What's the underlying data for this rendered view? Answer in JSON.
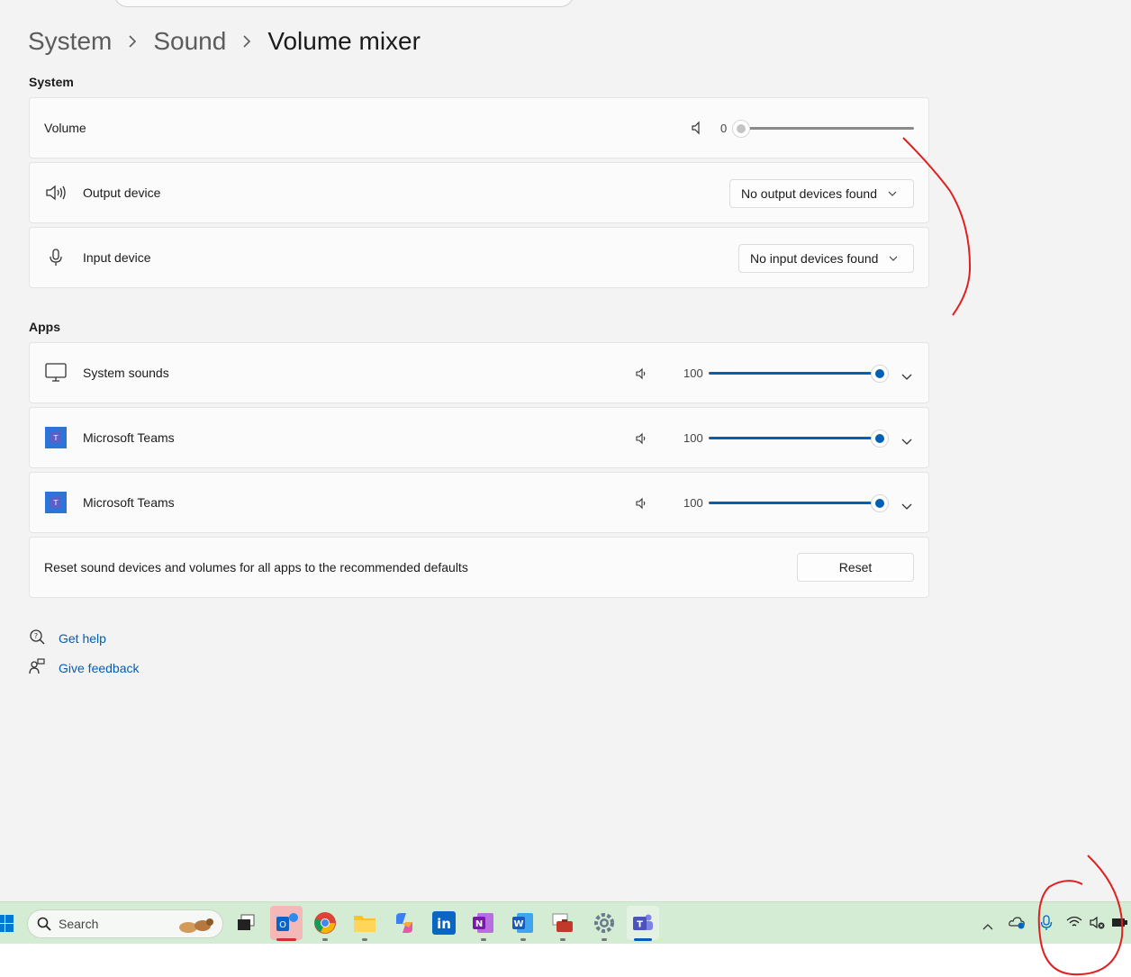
{
  "breadcrumb": {
    "level1": "System",
    "level2": "Sound",
    "current": "Volume mixer"
  },
  "sections": {
    "system": "System",
    "apps": "Apps"
  },
  "system": {
    "volume_label": "Volume",
    "volume_value": "0",
    "volume_level": 0,
    "output_label": "Output device",
    "output_value": "No output devices found",
    "input_label": "Input device",
    "input_value": "No input devices found"
  },
  "apps": [
    {
      "name": "System sounds",
      "value": "100",
      "icon": "monitor-icon",
      "level": 100
    },
    {
      "name": "Microsoft Teams",
      "value": "100",
      "icon": "teams-icon",
      "level": 100
    },
    {
      "name": "Microsoft Teams",
      "value": "100",
      "icon": "teams-icon",
      "level": 100
    }
  ],
  "reset": {
    "text": "Reset sound devices and volumes for all apps to the recommended defaults",
    "button": "Reset"
  },
  "links": {
    "help": "Get help",
    "feedback": "Give feedback"
  },
  "taskbar": {
    "search_placeholder": "Search",
    "apps": [
      "file-explorer-task-view-icon",
      "outlook-icon",
      "chrome-icon",
      "folder-icon",
      "copilot-icon",
      "linkedin-icon",
      "onenote-icon",
      "word-icon",
      "toolbox-icon",
      "settings-icon",
      "teams-icon"
    ],
    "tray": [
      "chevron-up-icon",
      "onedrive-icon",
      "microphone-icon",
      "wifi-icon",
      "speaker-muted-icon",
      "battery-icon"
    ]
  },
  "colors": {
    "accent": "#005fb8",
    "annotation": "#e02020",
    "taskbar": "#d3ecd3"
  }
}
